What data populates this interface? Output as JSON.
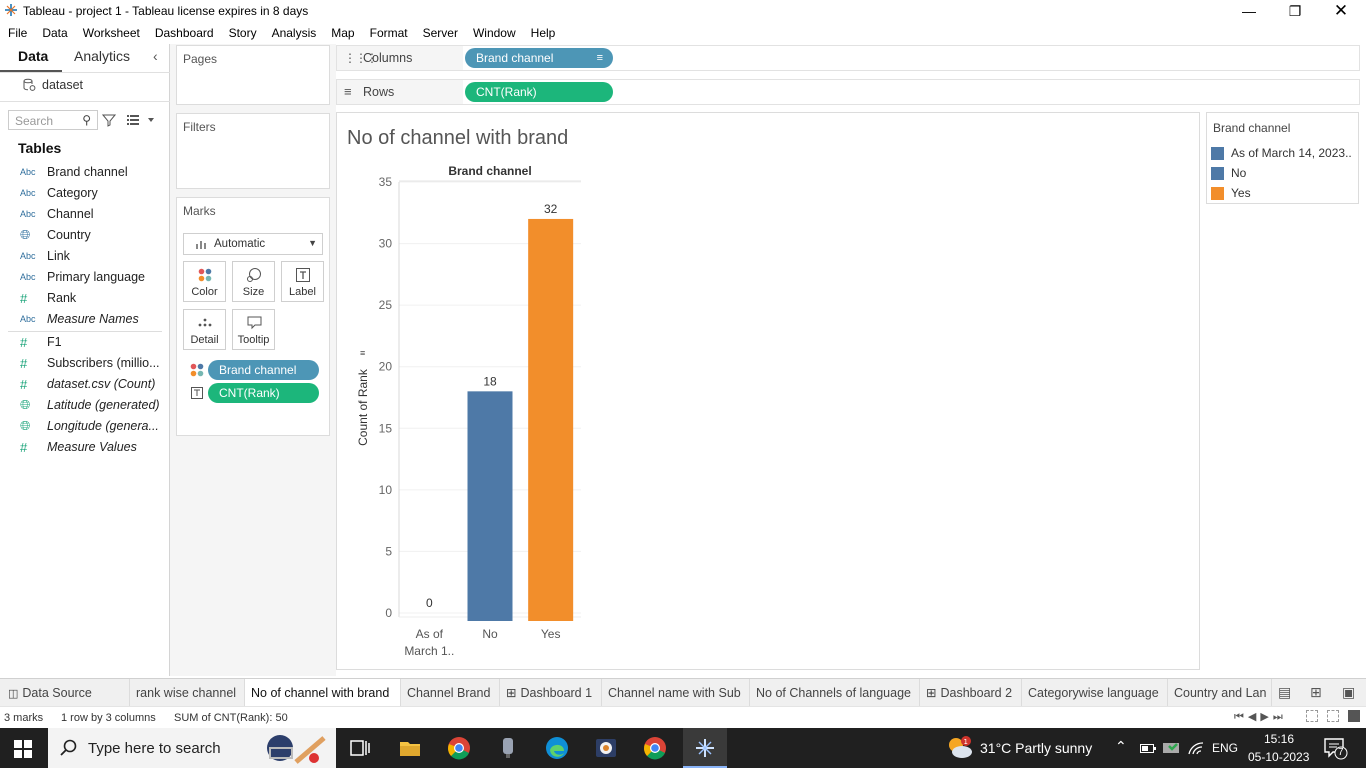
{
  "window": {
    "title": "Tableau - project 1 - Tableau license expires in 8 days"
  },
  "menu": [
    "File",
    "Data",
    "Worksheet",
    "Dashboard",
    "Story",
    "Analysis",
    "Map",
    "Format",
    "Server",
    "Window",
    "Help"
  ],
  "left_pane": {
    "tab_data": "Data",
    "tab_analytics": "Analytics",
    "datasource": "dataset",
    "search_placeholder": "Search",
    "tables_header": "Tables",
    "fields": [
      {
        "type": "Abc",
        "name": "Brand channel"
      },
      {
        "type": "Abc",
        "name": "Category"
      },
      {
        "type": "Abc",
        "name": "Channel"
      },
      {
        "type": "globe",
        "name": "Country"
      },
      {
        "type": "Abc",
        "name": "Link"
      },
      {
        "type": "Abc",
        "name": "Primary language"
      },
      {
        "type": "#",
        "name": "Rank"
      },
      {
        "type": "Abc",
        "name": "Measure Names"
      },
      {
        "type": "#",
        "name": "F1"
      },
      {
        "type": "#",
        "name": "Subscribers (millio..."
      },
      {
        "type": "#",
        "name": "dataset.csv (Count)"
      },
      {
        "type": "globe",
        "name": "Latitude (generated)"
      },
      {
        "type": "globe",
        "name": "Longitude (genera..."
      },
      {
        "type": "#",
        "name": "Measure Values"
      }
    ]
  },
  "cards": {
    "pages": "Pages",
    "filters": "Filters",
    "marks": "Marks",
    "mark_type": "Automatic",
    "buttons": [
      "Color",
      "Size",
      "Label",
      "Detail",
      "Tooltip"
    ],
    "mark_pills": [
      "Brand channel",
      "CNT(Rank)"
    ]
  },
  "shelves": {
    "columns_label": "Columns",
    "columns_pill": "Brand channel",
    "rows_label": "Rows",
    "rows_pill": "CNT(Rank)"
  },
  "colors": {
    "blue": "#4e79a7",
    "orange": "#f28e2b",
    "pill_blue": "#4d96b6",
    "pill_green": "#1cb67b"
  },
  "chart_data": {
    "type": "bar",
    "title": "No of channel with brand",
    "column_header": "Brand channel",
    "ylabel": "Count of Rank",
    "categories": [
      "As of March 1..",
      "No",
      "Yes"
    ],
    "values": [
      0,
      18,
      32
    ],
    "data_labels": [
      "0",
      "18",
      "32"
    ],
    "colors": [
      "#4e79a7",
      "#4e79a7",
      "#f28e2b"
    ],
    "ylim": [
      0,
      35
    ],
    "yticks": [
      "0",
      "5",
      "10",
      "15",
      "20",
      "25",
      "30",
      "35"
    ]
  },
  "legend": {
    "title": "Brand channel",
    "items": [
      {
        "label": "As of March 14, 2023..",
        "color": "#4e79a7"
      },
      {
        "label": "No",
        "color": "#4e79a7"
      },
      {
        "label": "Yes",
        "color": "#f28e2b"
      }
    ]
  },
  "sheet_tabs": [
    "Data Source",
    "rank wise channel",
    "No of channel with brand",
    "Channel Brand",
    "Dashboard 1",
    "Channel name with Sub",
    "No of Channels of language",
    "Dashboard 2",
    "Categorywise language",
    "Country and Lan"
  ],
  "status": {
    "marks": "3 marks",
    "rows_cols": "1 row by 3 columns",
    "sum": "SUM of CNT(Rank): 50"
  },
  "taskbar": {
    "search_text": "Type here to search",
    "weather": "31°C  Partly sunny",
    "lang": "ENG",
    "time": "15:16",
    "date": "05-10-2023",
    "notif_count": "7"
  }
}
